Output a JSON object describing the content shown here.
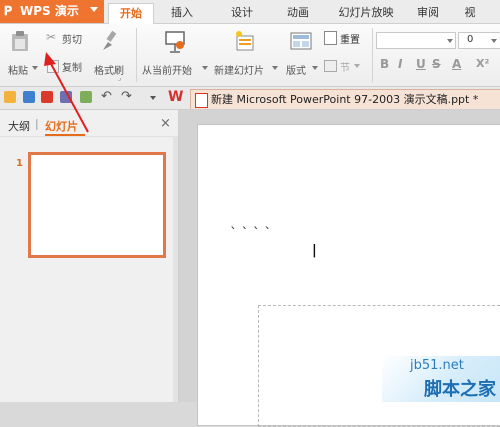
{
  "app": {
    "name": "WPS 演示",
    "logo_icon": "wps-presentation-logo-icon",
    "accent": "#ef7430"
  },
  "menu": {
    "tabs": [
      {
        "label": "开始",
        "active": true
      },
      {
        "label": "插入",
        "active": false
      },
      {
        "label": "设计",
        "active": false
      },
      {
        "label": "动画",
        "active": false
      },
      {
        "label": "幻灯片放映",
        "active": false
      },
      {
        "label": "审阅",
        "active": false
      },
      {
        "label": "视",
        "active": false
      }
    ]
  },
  "ribbon": {
    "paste": {
      "label": "粘贴",
      "icon": "clipboard-icon"
    },
    "cut": {
      "label": "剪切",
      "icon": "scissors-icon"
    },
    "copy": {
      "label": "复制",
      "icon": "copy-icon"
    },
    "format_painter": {
      "label": "格式刷",
      "icon": "brush-icon"
    },
    "start_from_current": {
      "label": "从当前开始",
      "icon": "projector-icon"
    },
    "new_slide": {
      "label": "新建幻灯片",
      "icon": "new-slide-icon"
    },
    "layout": {
      "label": "版式",
      "icon": "layout-icon"
    },
    "reset": {
      "label": "重置",
      "icon": "reset-icon"
    },
    "section": {
      "label": "节",
      "icon": "section-icon"
    },
    "font_size_value": "0",
    "font_buttons": [
      "B",
      "I",
      "U",
      "S",
      "A",
      "X²"
    ]
  },
  "qat": {
    "icons": [
      "open-folder-icon",
      "save-icon",
      "pdf-icon",
      "print-icon",
      "print-preview-icon",
      "undo-icon",
      "redo-icon",
      "customize-dropdown-icon"
    ],
    "wps_icon": "wps-w-icon",
    "document_title": "新建 Microsoft PowerPoint 97-2003 演示文稿.ppt *"
  },
  "left_panel": {
    "tab_outline": "大纲",
    "tab_divider": "|",
    "tab_slides": "幻灯片",
    "close_symbol": "×",
    "slide_number": "1"
  },
  "canvas": {
    "placeholder_mark": "` ` ` `",
    "cursor_mark": "|"
  },
  "watermark": {
    "url": "jb51.net",
    "site_name": "脚本之家"
  }
}
